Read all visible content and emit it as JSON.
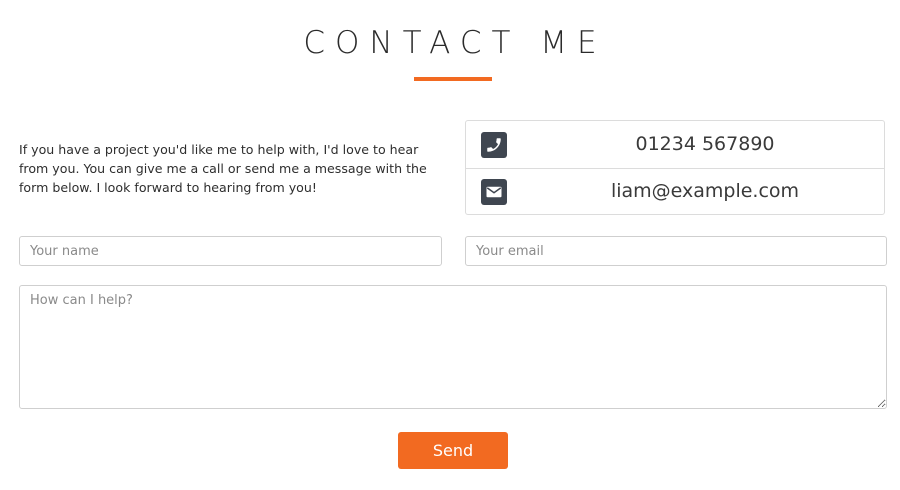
{
  "heading": {
    "title": "CONTACT ME",
    "accent_color": "#f26a21"
  },
  "intro": {
    "text": "If you have a project you'd like me to help with, I'd love to hear from you. You can give me a call or send me a message with the form below. I look forward to hearing from you!"
  },
  "contact": {
    "phone": {
      "icon": "phone-icon",
      "value": "01234 567890"
    },
    "email": {
      "icon": "envelope-icon",
      "value": "liam@example.com"
    }
  },
  "form": {
    "name_placeholder": "Your name",
    "name_value": "",
    "email_placeholder": "Your email",
    "email_value": "",
    "message_placeholder": "How can I help?",
    "message_value": "",
    "send_label": "Send"
  }
}
